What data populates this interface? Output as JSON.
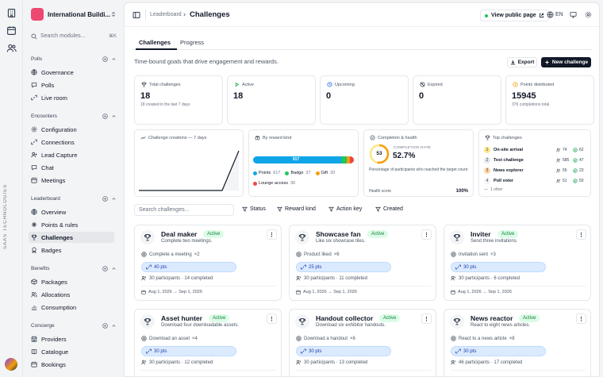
{
  "rail": {
    "vertical_text": "SAAS TECHNOLOGIES",
    "icons": [
      "building-icon",
      "calendar-icon",
      "users-icon"
    ]
  },
  "sidebar": {
    "org_name": "International Buildi...",
    "search_placeholder": "Search modules...",
    "search_shortcut": "⌘K",
    "sections": [
      {
        "title": "Polls",
        "items": [
          "Governance",
          "Polls",
          "Live room"
        ]
      },
      {
        "title": "Encounters",
        "items": [
          "Configuration",
          "Connections",
          "Lead Capture",
          "Chat",
          "Meetings"
        ]
      },
      {
        "title": "Leaderboard",
        "items": [
          "Overview",
          "Points & rules",
          "Challenges",
          "Badges"
        ]
      },
      {
        "title": "Benefits",
        "items": [
          "Packages",
          "Allocations",
          "Consumption"
        ]
      },
      {
        "title": "Concierge",
        "items": [
          "Providers",
          "Catalogue",
          "Bookings"
        ]
      }
    ],
    "active_item": "Challenges"
  },
  "topbar": {
    "breadcrumb_parent": "Leaderboard",
    "breadcrumb_current": "Challenges",
    "view_public": "View public page",
    "lang": "EN"
  },
  "tabs": [
    "Challenges",
    "Progress"
  ],
  "subtitle": "Time-bound goals that drive engagement and rewards.",
  "actions": {
    "export": "Export",
    "new": "New challenge"
  },
  "stats": [
    {
      "label": "Total challenges",
      "value": "18",
      "sub": "18 created in the last 7 days"
    },
    {
      "label": "Active",
      "value": "18",
      "sub": ""
    },
    {
      "label": "Upcoming",
      "value": "0",
      "sub": ""
    },
    {
      "label": "Expired",
      "value": "0",
      "sub": ""
    },
    {
      "label": "Points distributed",
      "value": "15945",
      "sub": "376 completions total"
    }
  ],
  "creations": {
    "title": "Challenge creations — 7 days",
    "series": [
      0,
      0,
      0,
      0,
      0,
      0,
      18
    ]
  },
  "reward_kind": {
    "title": "By reward kind",
    "bar_label": "917",
    "segments": [
      {
        "name": "Points",
        "value": 617,
        "color": "#0ea5e9"
      },
      {
        "name": "Badge",
        "value": 37,
        "color": "#22c55e"
      },
      {
        "name": "Gift",
        "value": 20,
        "color": "#f59e0b"
      },
      {
        "name": "Lounge access",
        "value": 30,
        "color": "#ef4444"
      }
    ]
  },
  "completion": {
    "title": "Completion & health",
    "ring_value": "53",
    "ring_fraction": 0.53,
    "rate_label": "COMPLETION RATE",
    "rate": "52.7%",
    "desc": "Percentage of participants who reached the target count",
    "health_label": "Health score",
    "health_value": "100%"
  },
  "top_challenges": {
    "title": "Top challenges",
    "rows": [
      {
        "rank": "1",
        "name": "On-site arrival",
        "members": "74",
        "completed": "62",
        "rank_color": "#fde68a"
      },
      {
        "rank": "2",
        "name": "Test challenge",
        "members": "585",
        "completed": "47",
        "rank_color": "#e5e7eb"
      },
      {
        "rank": "3",
        "name": "News explorer",
        "members": "55",
        "completed": "23",
        "rank_color": "#fed7aa"
      },
      {
        "rank": "4",
        "name": "Poll voter",
        "members": "51",
        "completed": "50",
        "rank_color": "#f3f4f6"
      }
    ],
    "other": "1 other"
  },
  "filters": {
    "search_placeholder": "Search challenges...",
    "buttons": [
      "Status",
      "Reward kind",
      "Action key",
      "Created"
    ]
  },
  "cards": [
    {
      "title": "Deal maker",
      "desc": "Complete two meetings.",
      "status": "Active",
      "action": "Complete a meeting",
      "target": "×2",
      "points": "40 pts",
      "progress": "30 participants · 14 completed",
      "dates": "Aug 1, 2026 → Sep 1, 2026"
    },
    {
      "title": "Showcase fan",
      "desc": "Like six showcase tiles.",
      "status": "Active",
      "action": "Product liked",
      "target": "×6",
      "points": "25 pts",
      "progress": "30 participants · 11 completed",
      "dates": "Aug 1, 2026 → Sep 1, 2026"
    },
    {
      "title": "Inviter",
      "desc": "Send three invitations.",
      "status": "Active",
      "action": "Invitation sent",
      "target": "×3",
      "points": "30 pts",
      "progress": "30 participants · 6 completed",
      "dates": "Aug 1, 2026 → Sep 1, 2026"
    },
    {
      "title": "Asset hunter",
      "desc": "Download four downloadable assets.",
      "status": "Active",
      "action": "Download an asset",
      "target": "×4",
      "points": "30 pts",
      "progress": "30 participants · 12 completed",
      "dates": ""
    },
    {
      "title": "Handout collector",
      "desc": "Download six exhibitor handouts.",
      "status": "Active",
      "action": "Download a handout",
      "target": "×6",
      "points": "30 pts",
      "progress": "30 participants · 13 completed",
      "dates": ""
    },
    {
      "title": "News reactor",
      "desc": "React to eight news articles.",
      "status": "Active",
      "action": "React to a news article",
      "target": "×8",
      "points": "30 pts",
      "progress": "46 participants · 17 completed",
      "dates": ""
    }
  ]
}
